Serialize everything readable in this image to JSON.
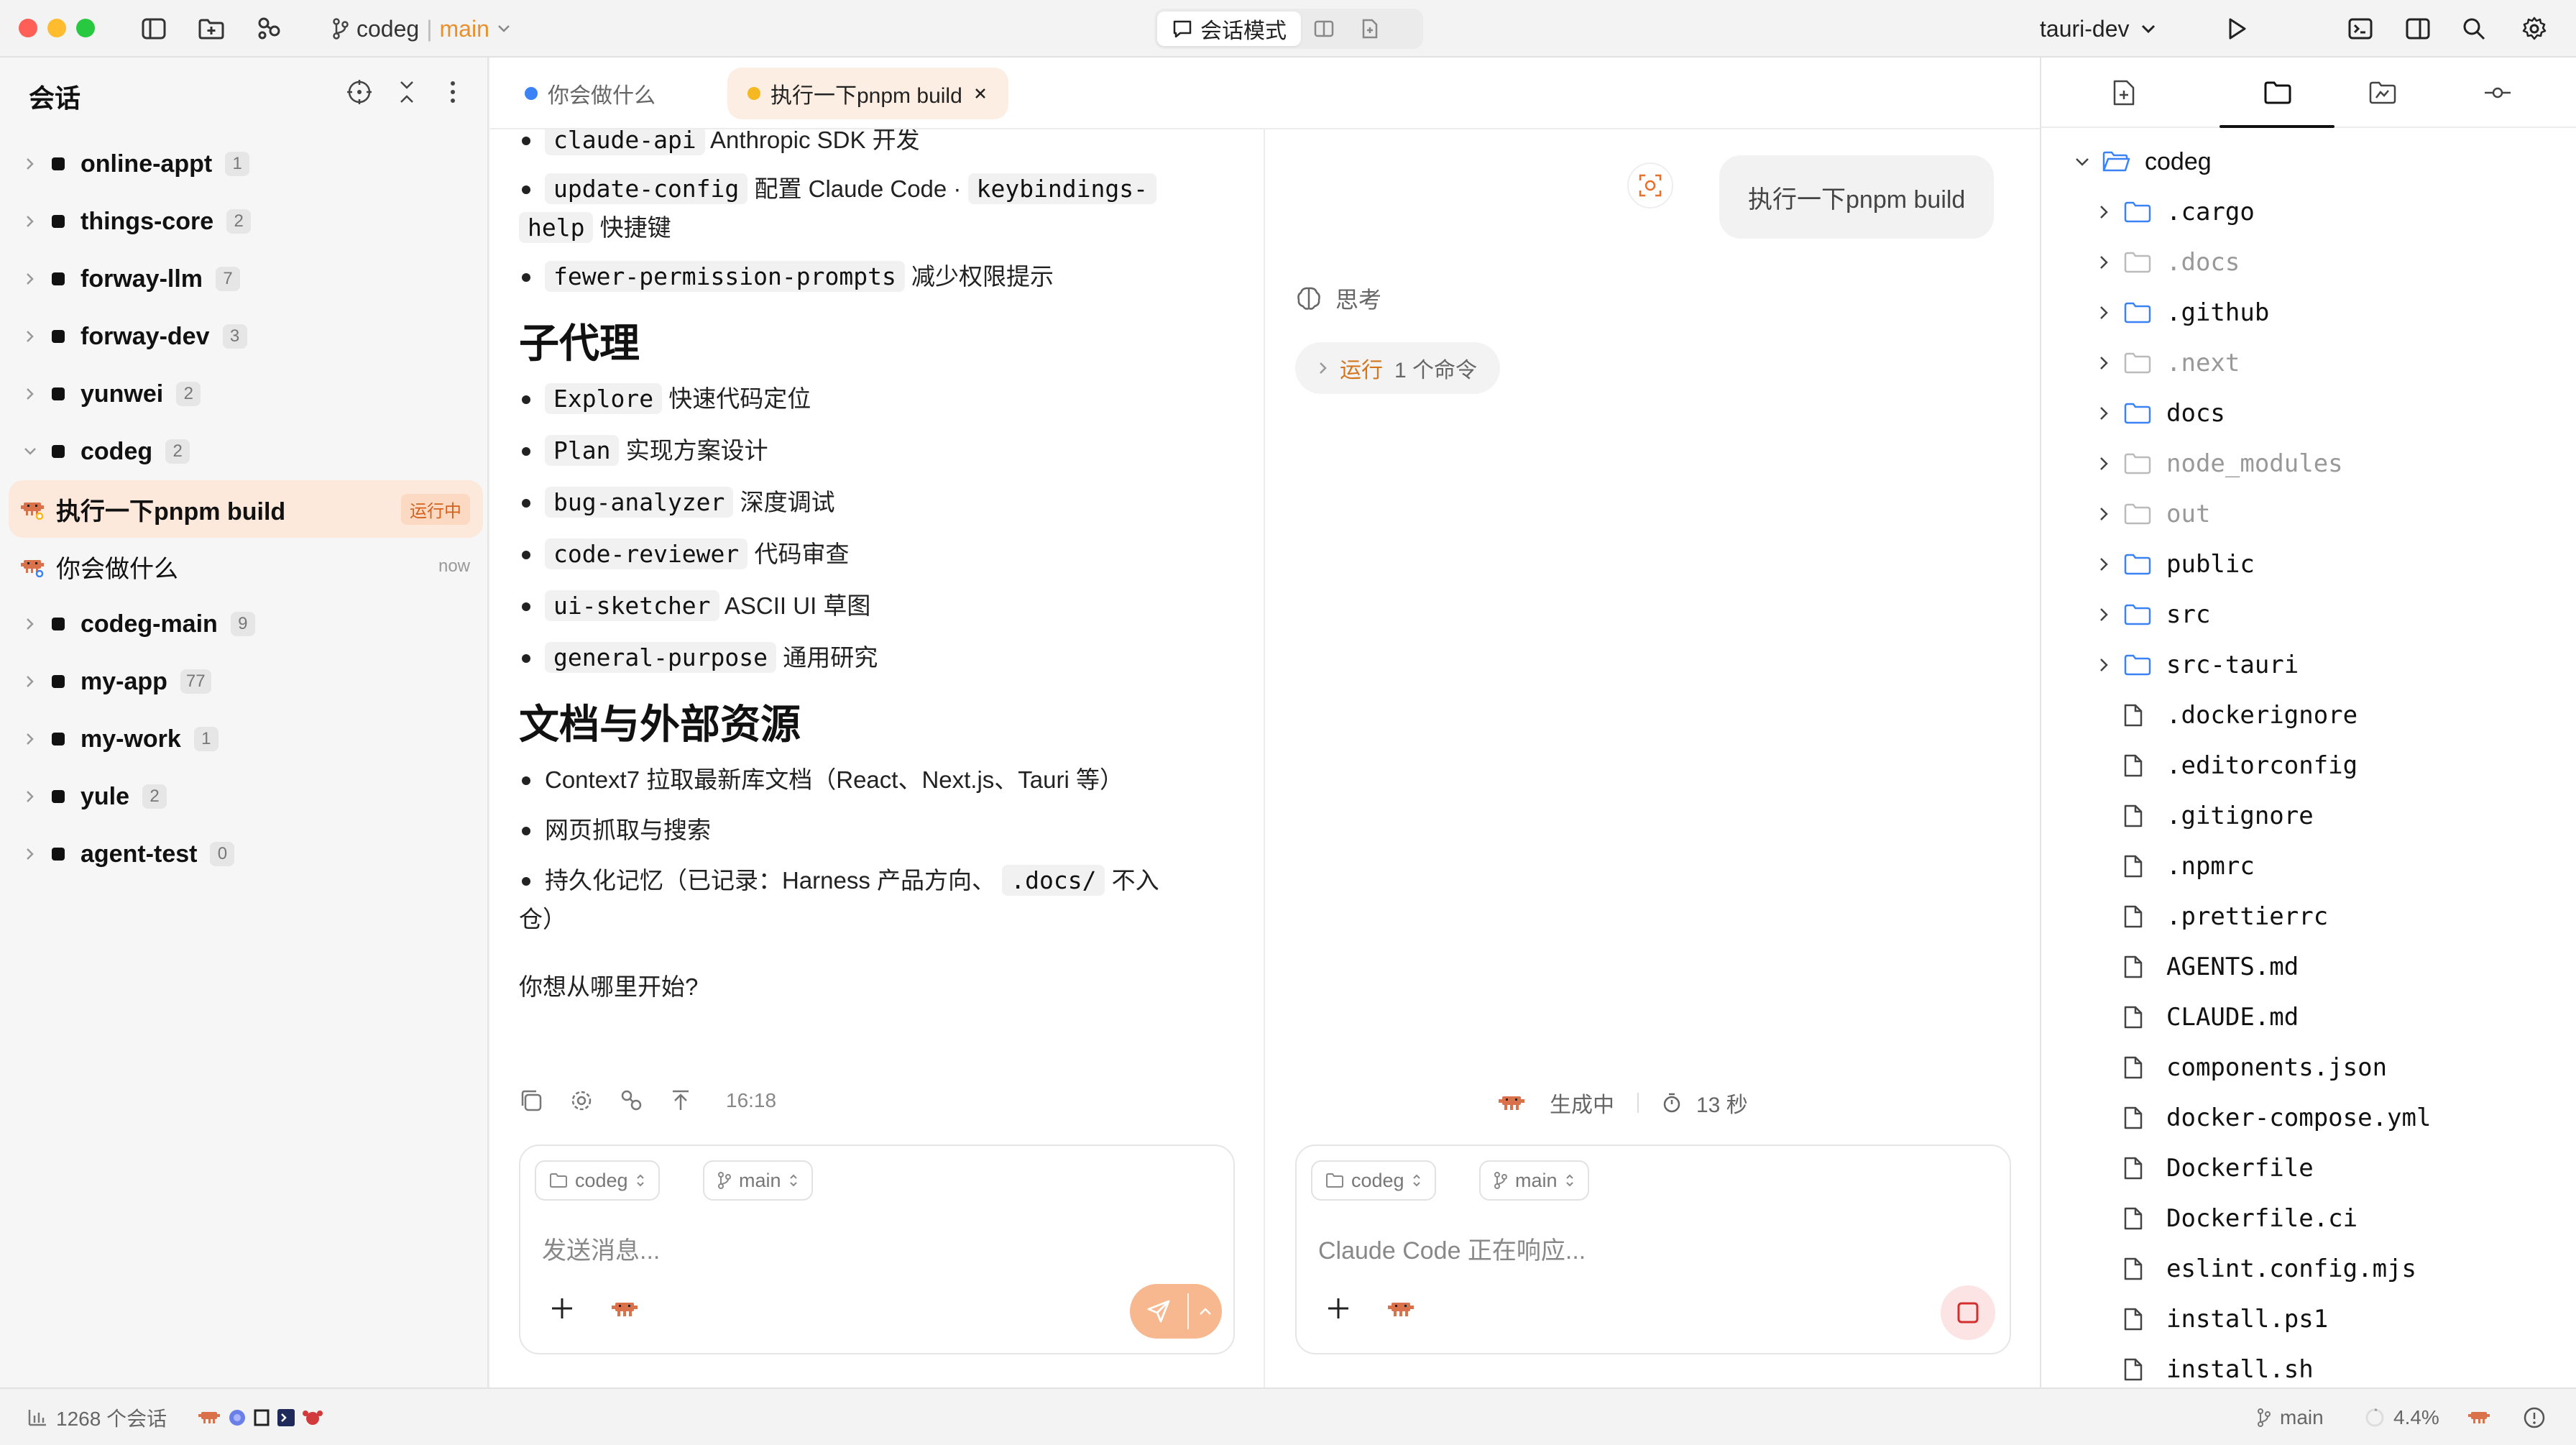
{
  "titlebar": {
    "repo": "codeg",
    "separator": "|",
    "branch": "main",
    "mode_chat": "会话模式",
    "run_target": "tauri-dev"
  },
  "sidebar": {
    "title": "会话",
    "groups_before": [
      {
        "name": "online-appt",
        "count": "1"
      },
      {
        "name": "things-core",
        "count": "2"
      },
      {
        "name": "forway-llm",
        "count": "7"
      },
      {
        "name": "forway-dev",
        "count": "3"
      },
      {
        "name": "yunwei",
        "count": "2"
      },
      {
        "name": "codeg",
        "count": "2"
      }
    ],
    "sessions": [
      {
        "name": "执行一下pnpm build",
        "status": "运行中"
      },
      {
        "name": "你会做什么",
        "time": "now"
      }
    ],
    "groups_after": [
      {
        "name": "codeg-main",
        "count": "9"
      },
      {
        "name": "my-app",
        "count": "77"
      },
      {
        "name": "my-work",
        "count": "1"
      },
      {
        "name": "yule",
        "count": "2"
      },
      {
        "name": "agent-test",
        "count": "0"
      }
    ]
  },
  "tabs": [
    {
      "label": "你会做什么",
      "dot": "#3b82f6"
    },
    {
      "label": "执行一下pnpm build",
      "dot": "#f5b820"
    }
  ],
  "left_pane": {
    "top_items": [
      {
        "code": "claude-api",
        "text": "Anthropic SDK 开发"
      },
      {
        "code": "update-config",
        "text": "配置 Claude Code ·",
        "code2": "keybindings-",
        "wrap": "help",
        "text2": "快捷键"
      },
      {
        "code": "fewer-permission-prompts",
        "text": "减少权限提示"
      }
    ],
    "section1_title": "子代理",
    "section1_items": [
      {
        "code": "Explore",
        "text": "快速代码定位"
      },
      {
        "code": "Plan",
        "text": "实现方案设计"
      },
      {
        "code": "bug-analyzer",
        "text": "深度调试"
      },
      {
        "code": "code-reviewer",
        "text": "代码审查"
      },
      {
        "code": "ui-sketcher",
        "text": "ASCII UI 草图"
      },
      {
        "code": "general-purpose",
        "text": "通用研究"
      }
    ],
    "section2_title": "文档与外部资源",
    "section2_items": [
      {
        "text": "Context7 拉取最新库文档（React、Next.js、Tauri 等）"
      },
      {
        "text": "网页抓取与搜索"
      },
      {
        "text": "持久化记忆（已记录：Harness 产品方向、",
        "code": ".docs/",
        "text2": "不入",
        "wrap": "仓）"
      }
    ],
    "question": "你想从哪里开始?",
    "time": "16:18",
    "composer": {
      "project": "codeg",
      "branch": "main",
      "placeholder": "发送消息..."
    }
  },
  "right_pane": {
    "user_message": "执行一下pnpm build",
    "thinking": "思考",
    "run_chip_hl": "运行",
    "run_chip_rest": "1 个命令",
    "generating": "生成中",
    "elapsed": "13 秒",
    "composer": {
      "project": "codeg",
      "branch": "main",
      "placeholder": "Claude Code 正在响应..."
    }
  },
  "file_tree": {
    "root": "codeg",
    "folders": [
      {
        "name": ".cargo",
        "dim": false
      },
      {
        "name": ".docs",
        "dim": true
      },
      {
        "name": ".github",
        "dim": false
      },
      {
        "name": ".next",
        "dim": true
      },
      {
        "name": "docs",
        "dim": false
      },
      {
        "name": "node_modules",
        "dim": true
      },
      {
        "name": "out",
        "dim": true
      },
      {
        "name": "public",
        "dim": false
      },
      {
        "name": "src",
        "dim": false
      },
      {
        "name": "src-tauri",
        "dim": false
      }
    ],
    "files": [
      ".dockerignore",
      ".editorconfig",
      ".gitignore",
      ".npmrc",
      ".prettierrc",
      "AGENTS.md",
      "CLAUDE.md",
      "components.json",
      "docker-compose.yml",
      "Dockerfile",
      "Dockerfile.ci",
      "eslint.config.mjs",
      "install.ps1",
      "install.sh"
    ]
  },
  "statusbar": {
    "session_count": "1268 个会话",
    "branch": "main",
    "usage": "4.4%"
  },
  "colors": {
    "accent": "#e8902b",
    "active_bg": "#fde8dc",
    "send_button": "#f7b88f",
    "stop_button": "#d32f2f"
  }
}
